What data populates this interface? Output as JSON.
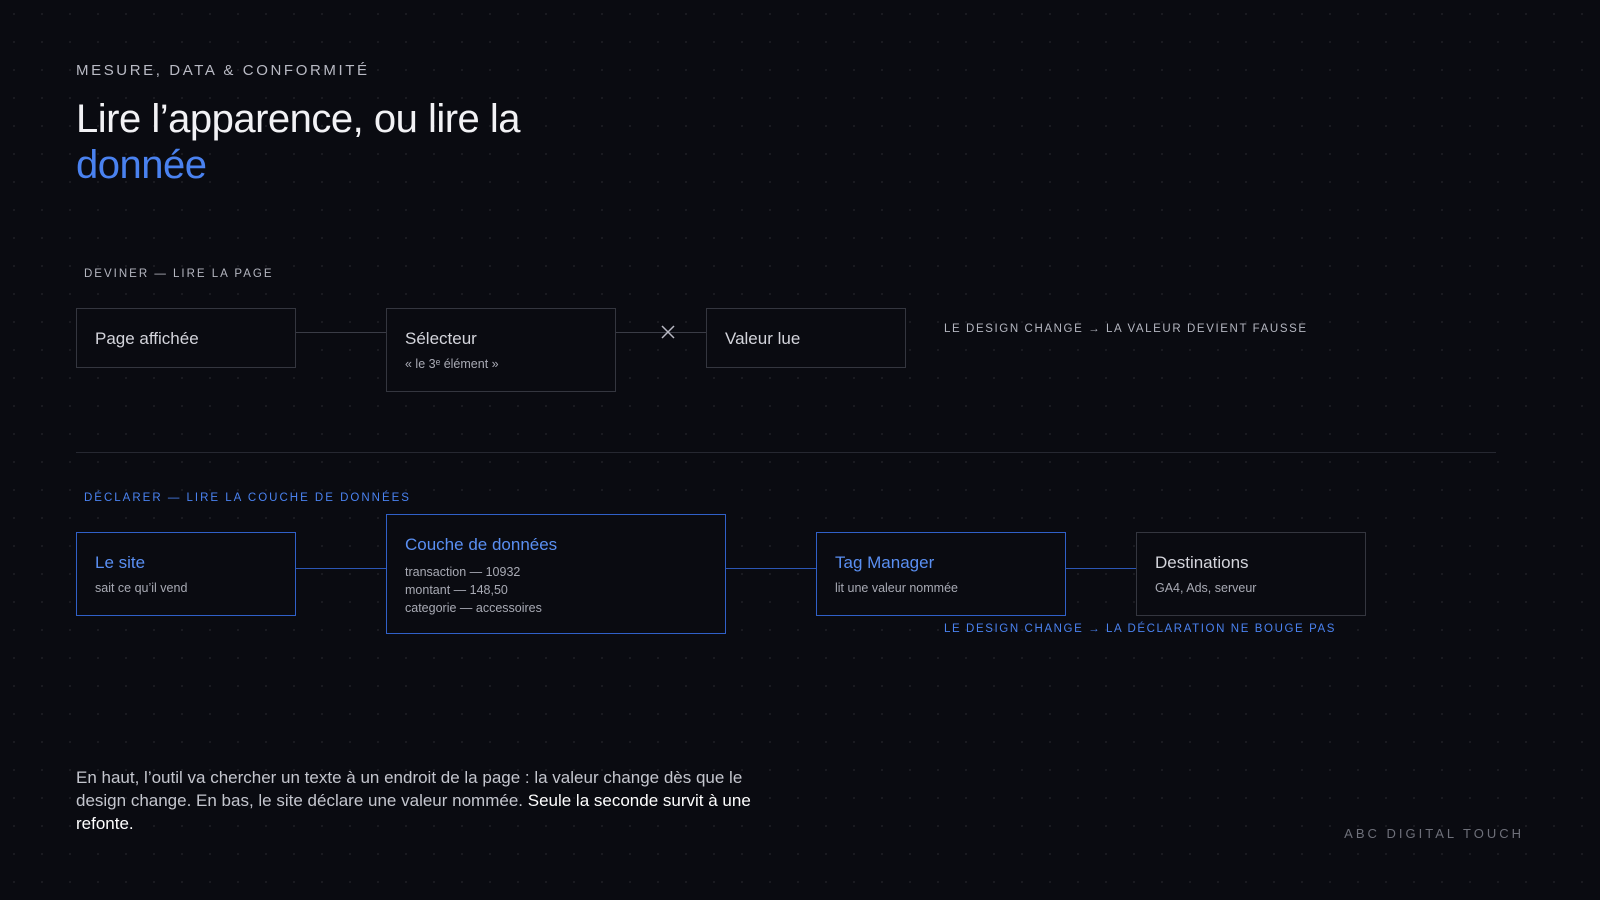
{
  "header": {
    "eyebrow": "MESURE, DATA & CONFORMITÉ",
    "title_line1": "Lire l’apparence, ou lire la",
    "title_accent": "donnée"
  },
  "guess": {
    "label": "DEVINER — LIRE LA PAGE",
    "boxes": [
      {
        "title": "Page affichée"
      },
      {
        "title": "Sélecteur",
        "sub": "« le 3ᵉ élément »"
      },
      {
        "title": "Valeur lue"
      }
    ],
    "note": "LE DESIGN CHANGE → LA VALEUR DEVIENT FAUSSE",
    "break_icon": "cross-icon"
  },
  "declare": {
    "label": "DÉCLARER — LIRE LA COUCHE DE DONNÉES",
    "boxes": [
      {
        "title": "Le site",
        "sub": "sait ce qu’il vend"
      },
      {
        "title": "Couche de données",
        "lines": [
          "transaction — 10932",
          "montant — 148,50",
          "categorie — accessoires"
        ]
      },
      {
        "title": "Tag Manager",
        "sub": "lit une valeur nommée"
      },
      {
        "title": "Destinations",
        "sub": "GA4, Ads, serveur"
      }
    ],
    "note": "LE DESIGN CHANGE → LA DÉCLARATION NE BOUGE PAS"
  },
  "footer": {
    "text": "En haut, l’outil va chercher un texte à un endroit de la page : la valeur change dès que le design change. En bas, le site déclare une valeur nommée. ",
    "strong": "Seule la seconde survit à une refonte.",
    "brand": "ABC DIGITAL TOUCH"
  },
  "colors": {
    "background": "#0a0b11",
    "accent": "#4a82f0",
    "neutral_border": "#34363f"
  }
}
